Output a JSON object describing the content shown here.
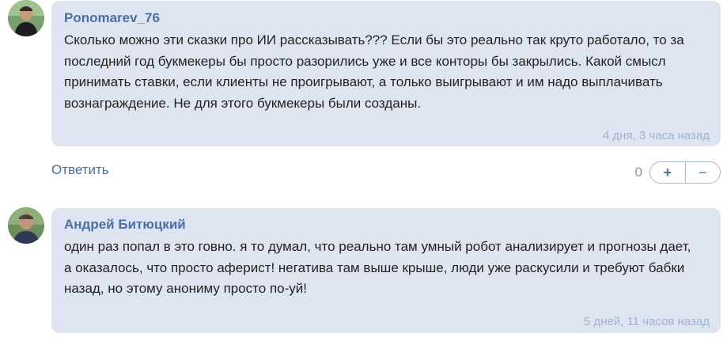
{
  "comments": [
    {
      "author": "Ponomarev_76",
      "avatar": "avatar-photo",
      "lines": [
        "Сколько можно эти сказки про ИИ рассказывать??? Если бы это реально так круто работало, то за",
        "последний год букмекеры бы просто разорились уже и все конторы бы закрылись. Какой смысл",
        "принимать ставки, если клиенты не проигрывают, а только выигрывают и им надо выплачивать",
        "вознаграждение. Не для этого букмекеры были созданы."
      ],
      "time": "4 дня, 3 часа назад"
    },
    {
      "author": "Андрей Битюцкий",
      "avatar": "avatar-photo",
      "lines": [
        "один раз попал в это говно. я то думал, что реально там умный робот анализирует и прогнозы дает,",
        "а оказалось, что просто аферист! негатива там выше крыше, люди уже раскусили и требуют бабки",
        "назад, но этому анониму просто по-уй!"
      ],
      "time": "5 дней, 11 часов назад"
    }
  ],
  "actions": {
    "reply_label": "Ответить",
    "vote_count": "0",
    "plus_label": "+",
    "minus_label": "−"
  },
  "colors": {
    "bubble": "#dfe5f0",
    "author": "#4a6fa3",
    "timestamp": "#9fb3d0"
  }
}
